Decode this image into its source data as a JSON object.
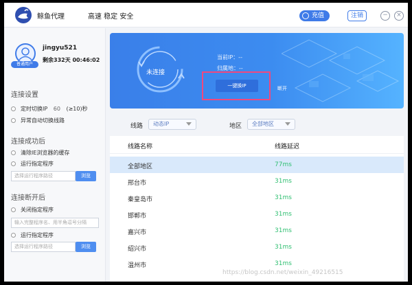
{
  "titlebar": {
    "app_name": "鲸鱼代理",
    "slogan": "高速 稳定 安全",
    "recharge_label": "充值",
    "logout_label": "注销",
    "minimize_icon": "−",
    "close_icon": "×"
  },
  "user": {
    "badge": "普通用户",
    "username": "jingyu521",
    "remaining": "剩余332天 00:46:02"
  },
  "settings": {
    "section_connect": "连接设置",
    "timed_switch_prefix": "定时切换IP",
    "timed_switch_value": "60",
    "timed_switch_suffix": "(≥10)秒",
    "auto_switch_on_error": "异常自动切换线路",
    "section_after_connect": "连接成功后",
    "clear_ie_cache": "清除IE浏览器的缓存",
    "run_program": "运行指定程序",
    "program_path_placeholder": "选择运行程序路径",
    "browse_label": "浏览",
    "section_after_disconnect": "连接断开后",
    "close_program": "关闭指定程序",
    "close_program_placeholder": "输入完整程序名、用半角逗号分隔",
    "run_program_2": "运行指定程序",
    "program_path_placeholder_2": "选择运行程序路径",
    "browse_label_2": "浏览"
  },
  "connection": {
    "status": "未连接",
    "current_ip_label": "当前IP：--",
    "location_label": "归属地：--",
    "switch_ip_label": "一键换IP",
    "disconnect_label": "断开"
  },
  "filters": {
    "line_label": "线路",
    "line_value": "动态IP",
    "region_label": "地区",
    "region_value": "全部地区"
  },
  "table": {
    "headers": [
      "线路名称",
      "线路延迟"
    ],
    "rows": [
      {
        "name": "全部地区",
        "latency": "77ms",
        "selected": true
      },
      {
        "name": "邢台市",
        "latency": "31ms",
        "selected": false
      },
      {
        "name": "秦皇岛市",
        "latency": "31ms",
        "selected": false
      },
      {
        "name": "邯郸市",
        "latency": "31ms",
        "selected": false
      },
      {
        "name": "嘉兴市",
        "latency": "31ms",
        "selected": false
      },
      {
        "name": "绍兴市",
        "latency": "31ms",
        "selected": false
      },
      {
        "name": "温州市",
        "latency": "31ms",
        "selected": false
      }
    ]
  },
  "watermark": "https://blog.csdn.net/weixin_49216515",
  "colors": {
    "accent": "#3f7be8",
    "latency_good": "#2fbf71",
    "highlight_box": "#f2487d"
  }
}
